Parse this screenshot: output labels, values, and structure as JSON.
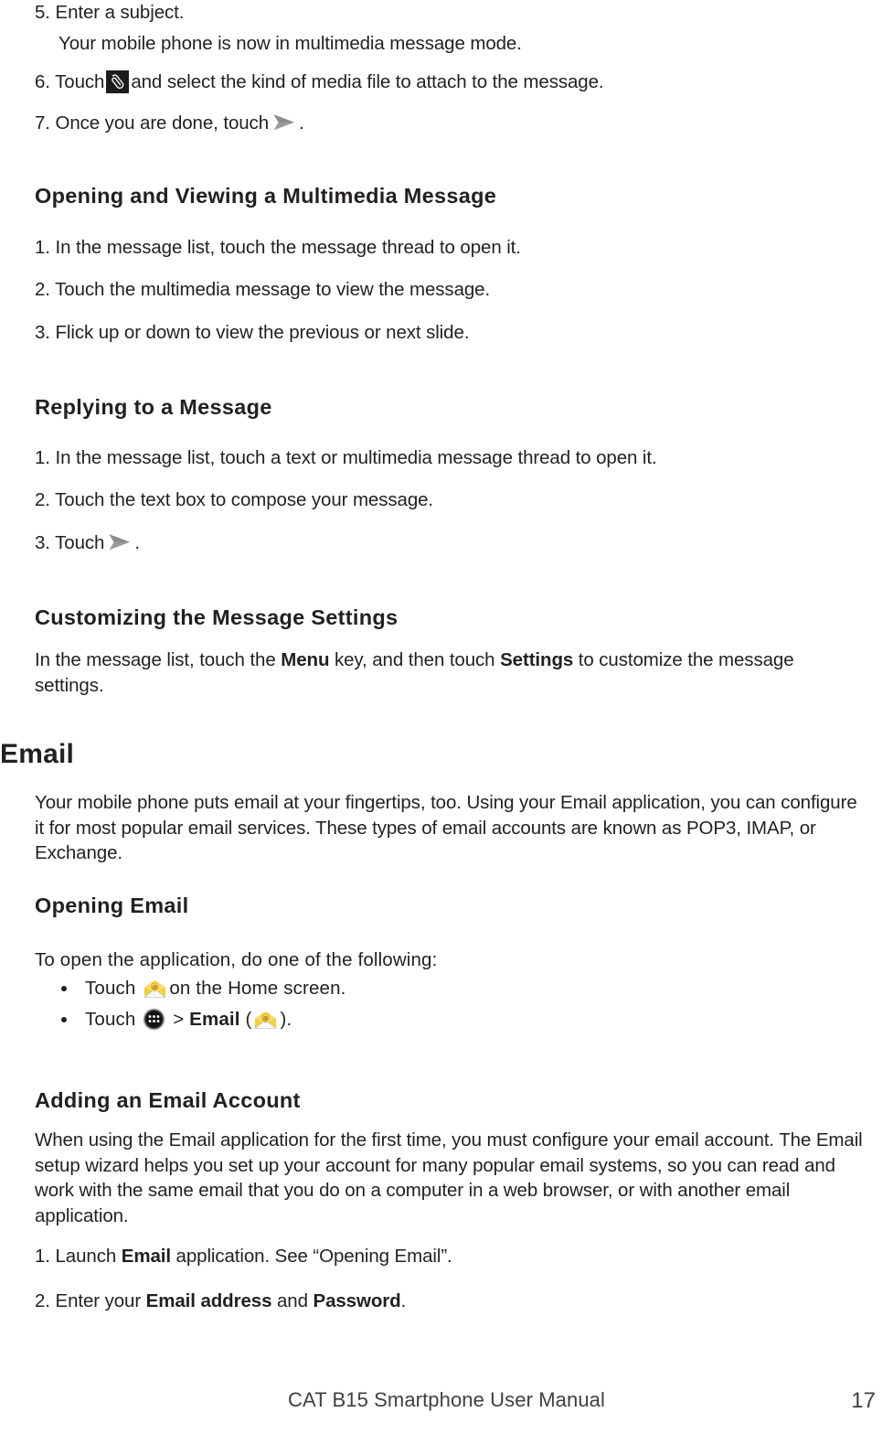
{
  "document": {
    "footer_title": "CAT B15 Smartphone User Manual",
    "page_number": "17"
  },
  "colors": {
    "text": "#231f20",
    "footer_text": "#3f3f3f",
    "icon_accent": "#f5c518",
    "icon_dark": "#1c1c1c",
    "send_arrow": "#999999",
    "page_background": "#ffffff"
  },
  "top_steps": {
    "step5": "5. Enter a subject.",
    "step5_note": "Your mobile phone is now in multimedia message mode.",
    "step6_before": "6. Touch",
    "step6_after": "and select the kind of media file to attach to the message.",
    "step7_before": "7. Once you are done, touch",
    "step7_after": "."
  },
  "section_opening_viewing": {
    "heading": "Opening and Viewing a Multimedia Message",
    "steps": [
      "1. In the message list, touch the message thread to open it.",
      "2. Touch the multimedia message to view the message.",
      "3. Flick up or down to view the previous or next slide."
    ]
  },
  "section_replying": {
    "heading": "Replying to a Message",
    "steps": [
      "1. In the message list, touch a text or multimedia message thread to open it.",
      "2. Touch the text box to compose your message."
    ],
    "step3_before": "3. Touch",
    "step3_after": "."
  },
  "section_customizing": {
    "heading": "Customizing the Message Settings",
    "body_part1": "In the message list, touch the ",
    "body_bold1": "Menu",
    "body_part2": " key, and then touch ",
    "body_bold2": "Settings",
    "body_part3": " to customize the message settings."
  },
  "chapter_email": {
    "heading": "Email",
    "intro": "Your mobile phone puts email at your fingertips, too. Using your Email application, you can configure it for most popular email services. These types of email accounts are known as POP3, IMAP, or Exchange."
  },
  "section_opening_email": {
    "heading": "Opening Email",
    "lead": "To open the application, do one of the following:",
    "bullet1_before": "Touch",
    "bullet1_after": "on the Home screen.",
    "bullet2_before": "Touch",
    "bullet2_mid": ">",
    "bullet2_bold": "Email",
    "bullet2_open_paren": "(",
    "bullet2_close_paren": ")."
  },
  "section_adding_account": {
    "heading": "Adding an Email Account",
    "body": "When using the Email application for the first time, you must configure your email account. The Email setup wizard helps you set up your account for many popular email systems, so you can read and work with the same email that you do on a computer in a web browser, or with another email application.",
    "step1_prefix": "1. Launch ",
    "step1_bold": "Email",
    "step1_suffix": " application. See “Opening Email”.",
    "step2_prefix": "2. Enter your ",
    "step2_bold1": "Email address",
    "step2_mid": " and ",
    "step2_bold2": "Password",
    "step2_suffix": "."
  },
  "icons": {
    "attach": "paperclip-icon",
    "send": "send-arrow-icon",
    "email_app": "email-envelope-icon",
    "app_drawer": "app-drawer-icon"
  }
}
